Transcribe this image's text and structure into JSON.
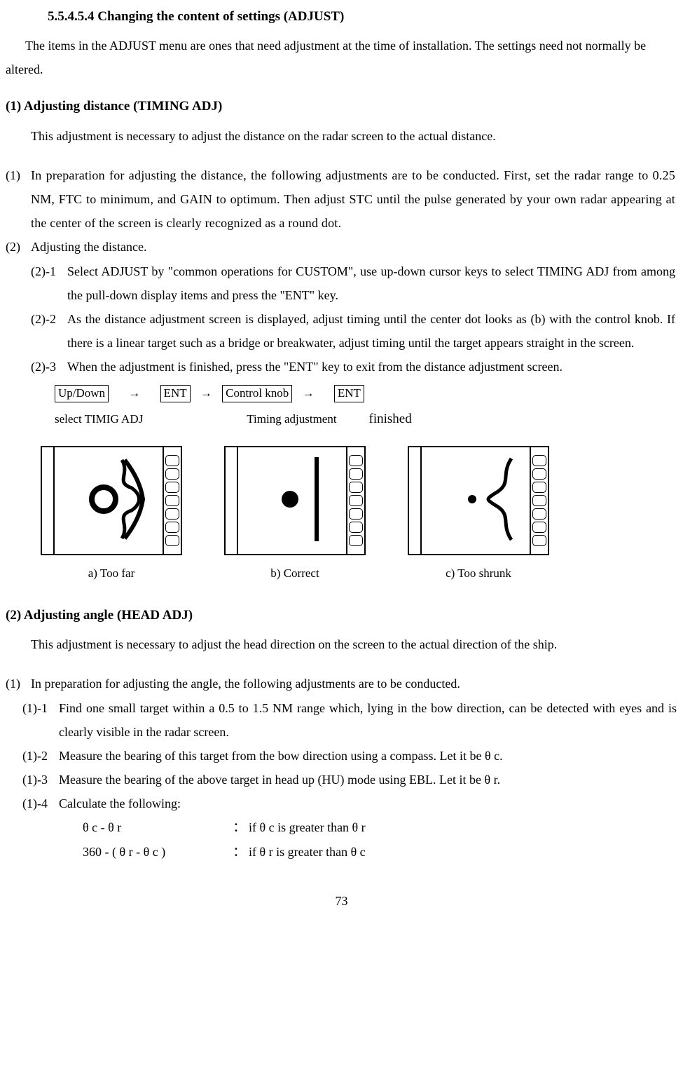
{
  "heading": "5.5.4.5.4 Changing the content of settings (ADJUST)",
  "intro": "The items in the ADJUST menu are ones that need adjustment at the time of installation.   The settings need not normally be altered.",
  "section1": {
    "title": "(1) Adjusting distance (TIMING ADJ)",
    "body": "This adjustment is necessary to adjust the distance on the radar screen to the actual distance.",
    "item1_num": "(1)",
    "item1": "In preparation for adjusting the distance, the following adjustments are to be conducted. First, set the radar range to 0.25 NM, FTC to minimum, and GAIN to optimum. Then adjust STC until the pulse generated by your own radar appearing at the center of the screen is clearly recognized as a round dot.",
    "item2_num": "(2)",
    "item2": "Adjusting the distance.",
    "sub21_num": "(2)-1",
    "sub21": "Select ADJUST by \"common operations for CUSTOM\", use up-down cursor keys to select TIMING ADJ from among the pull-down display items and press the \"ENT\" key.",
    "sub22_num": "(2)-2",
    "sub22": "As the distance adjustment screen is displayed, adjust timing until the center dot looks as (b) with the control knob. If there is a linear target such as a bridge or breakwater, adjust timing until the target appears straight in the screen.",
    "sub23_num": "(2)-3",
    "sub23": "When the adjustment is finished, press the \"ENT\" key to exit from the distance adjustment screen.",
    "flow": {
      "box1": "Up/Down",
      "box2": "ENT",
      "box3": "Control knob",
      "box4": "ENT",
      "arrow": "→",
      "label1": "select TIMIG ADJ",
      "label2": "Timing adjustment",
      "label3": "finished"
    },
    "captions": {
      "a": "a) Too far",
      "b": "b) Correct",
      "c": "c) Too shrunk"
    }
  },
  "section2": {
    "title": "(2) Adjusting angle (HEAD ADJ)",
    "body": "This adjustment is necessary to adjust the head direction on the screen to the actual direction of the ship.",
    "item1_num": "(1)",
    "item1": "In preparation for adjusting the angle, the following adjustments are to be conducted.",
    "sub11_num": "(1)-1",
    "sub11": "Find one small target within a 0.5 to 1.5 NM range which, lying in the bow direction, can be detected with eyes and is clearly visible in the radar screen.",
    "sub12_num": "(1)-2",
    "sub12": "Measure the bearing of this target from the bow direction using a compass. Let it be θ c.",
    "sub13_num": "(1)-3",
    "sub13": "Measure the bearing of the above target in head up (HU) mode using EBL. Let it be θ r.",
    "sub14_num": "(1)-4",
    "sub14": "Calculate the following:",
    "calc1_expr": "θ c - θ r",
    "calc1_cond": "： if θ c is greater than θ r",
    "calc2_expr": "360 - ( θ r - θ c )",
    "calc2_cond": "： if θ r is greater than θ c"
  },
  "page_number": "73"
}
